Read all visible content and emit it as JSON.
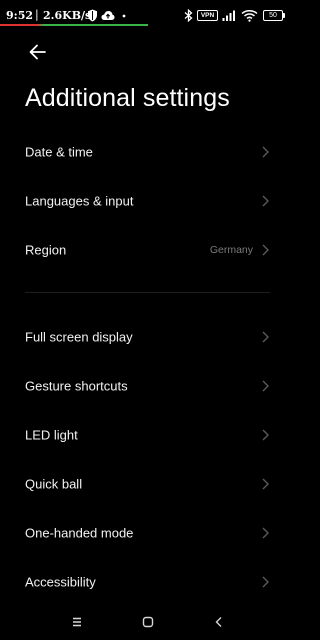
{
  "status_bar": {
    "time": "9:52",
    "separator": "|",
    "net_speed": "2.6KB/s",
    "vpn": "VPN",
    "battery": "50",
    "icons": [
      "shield-icon",
      "cloud-upload-icon",
      "dot-icon",
      "bluetooth-icon",
      "vpn-icon",
      "signal-icon",
      "wifi-icon",
      "battery-icon"
    ]
  },
  "header": {
    "back_icon": "arrow-left-icon",
    "title": "Additional settings"
  },
  "group1": [
    {
      "label": "Date & time",
      "value": ""
    },
    {
      "label": "Languages & input",
      "value": ""
    },
    {
      "label": "Region",
      "value": "Germany"
    }
  ],
  "group2": [
    {
      "label": "Full screen display",
      "value": ""
    },
    {
      "label": "Gesture shortcuts",
      "value": ""
    },
    {
      "label": "LED light",
      "value": ""
    },
    {
      "label": "Quick ball",
      "value": ""
    },
    {
      "label": "One-handed mode",
      "value": ""
    },
    {
      "label": "Accessibility",
      "value": ""
    }
  ],
  "nav_bar": {
    "icons": [
      "menu-icon",
      "home-icon",
      "back-icon"
    ]
  },
  "colors": {
    "background": "#000000",
    "text": "#f2f2f2",
    "secondary_text": "#7a7a7a",
    "chevron": "#5a5a5a"
  }
}
